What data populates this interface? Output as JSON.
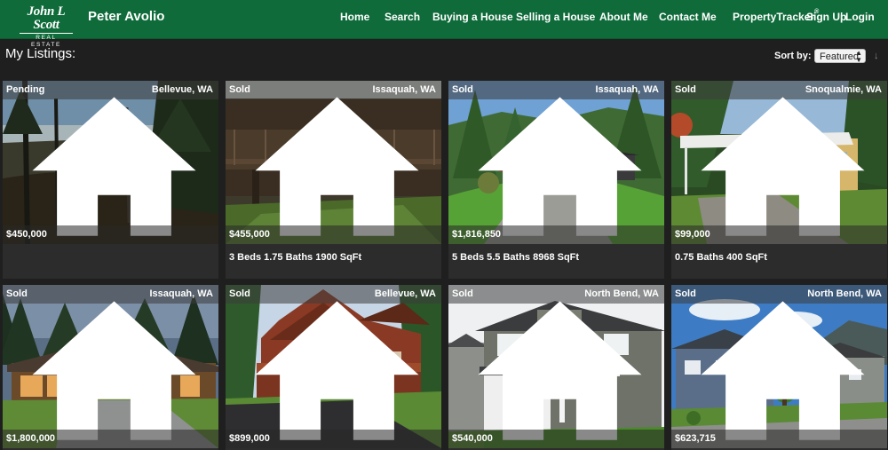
{
  "brand": {
    "logo_line1": "John L Scott",
    "logo_line2": "REAL ESTATE",
    "agent": "Peter Avolio"
  },
  "nav": {
    "home": "Home",
    "search": "Search",
    "buying": "Buying a House",
    "selling": "Selling a House",
    "about": "About Me",
    "contact": "Contact Me",
    "tracker": "PropertyTracker",
    "tracker_mark": "®",
    "signup": "Sign Up",
    "separator": "|",
    "login": "Login"
  },
  "page": {
    "title": "My Listings:",
    "sort_label": "Sort by:",
    "sort_value": "Featured"
  },
  "listings": [
    {
      "status": "Pending",
      "city": "Bellevue, WA",
      "price": "$450,000",
      "details": ""
    },
    {
      "status": "Sold",
      "city": "Issaquah, WA",
      "price": "$455,000",
      "details": "3 Beds 1.75 Baths 1900 SqFt"
    },
    {
      "status": "Sold",
      "city": "Issaquah, WA",
      "price": "$1,816,850",
      "details": "5 Beds 5.5 Baths 8968 SqFt"
    },
    {
      "status": "Sold",
      "city": "Snoqualmie, WA",
      "price": "$99,000",
      "details": "0.75 Baths 400 SqFt"
    },
    {
      "status": "Sold",
      "city": "Issaquah, WA",
      "price": "$1,800,000",
      "details": ""
    },
    {
      "status": "Sold",
      "city": "Bellevue, WA",
      "price": "$899,000",
      "details": ""
    },
    {
      "status": "Sold",
      "city": "North Bend, WA",
      "price": "$540,000",
      "details": ""
    },
    {
      "status": "Sold",
      "city": "North Bend, WA",
      "price": "$623,715",
      "details": ""
    }
  ],
  "icons": {
    "status_icon": "home-icon",
    "sort_caret": "updown-caret-icon",
    "sort_direction": "arrow-down-icon"
  },
  "colors": {
    "nav_bg": "#0f6b3a",
    "page_bg": "#1f1f1f",
    "card_bg": "#2c2c2c"
  }
}
